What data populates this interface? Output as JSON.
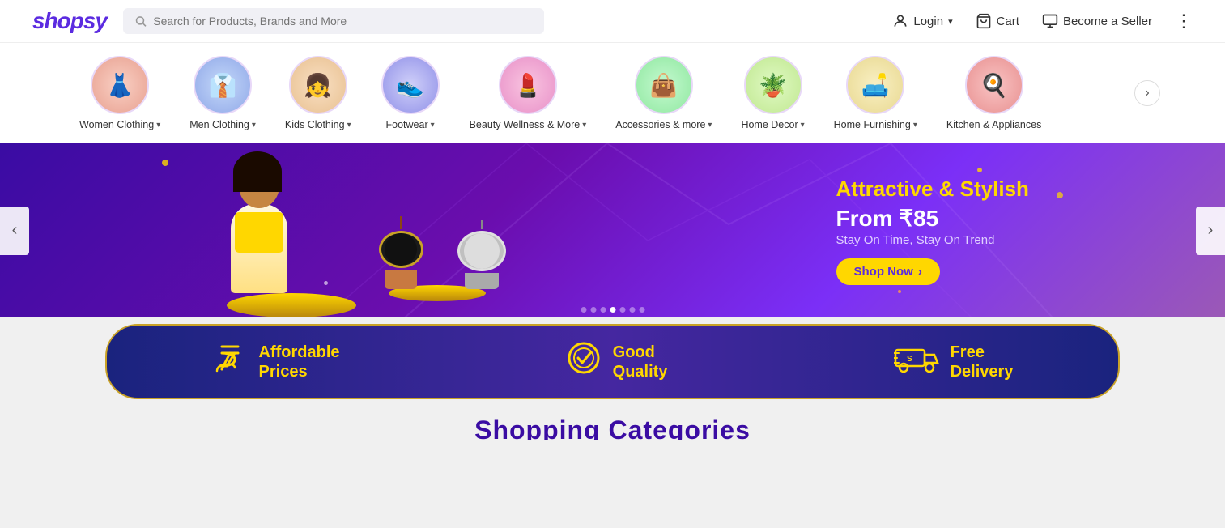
{
  "header": {
    "logo": "shopsy",
    "search": {
      "placeholder": "Search for Products, Brands and More"
    },
    "actions": {
      "login": "Login",
      "cart": "Cart",
      "become_seller": "Become a Seller"
    }
  },
  "nav": {
    "prev_arrow": "‹",
    "next_arrow": "›",
    "categories": [
      {
        "label": "Women Clothing",
        "has_dropdown": true,
        "icon": "👗",
        "circle_class": "women-circle"
      },
      {
        "label": "Men Clothing",
        "has_dropdown": true,
        "icon": "👔",
        "circle_class": "men-circle"
      },
      {
        "label": "Kids Clothing",
        "has_dropdown": true,
        "icon": "👧",
        "circle_class": "kids-circle"
      },
      {
        "label": "Footwear",
        "has_dropdown": true,
        "icon": "👟",
        "circle_class": "footwear-circle"
      },
      {
        "label": "Beauty Wellness & More",
        "has_dropdown": true,
        "icon": "💄",
        "circle_class": "beauty-circle"
      },
      {
        "label": "Accessories & more",
        "has_dropdown": true,
        "icon": "👜",
        "circle_class": "accessories-circle"
      },
      {
        "label": "Home Decor",
        "has_dropdown": true,
        "icon": "🪴",
        "circle_class": "homedecor-circle"
      },
      {
        "label": "Home Furnishing",
        "has_dropdown": true,
        "icon": "🛋️",
        "circle_class": "homefurnishing-circle"
      },
      {
        "label": "Kitchen & Appliances",
        "has_dropdown": false,
        "icon": "🍳",
        "circle_class": "kitchen-circle"
      }
    ]
  },
  "banner": {
    "title": "Attractive & Stylish",
    "price_label": "From ₹85",
    "subtitle": "Stay On Time, Stay On Trend",
    "cta": "Shop Now",
    "dots": [
      false,
      false,
      false,
      true,
      false,
      false,
      false
    ]
  },
  "features": [
    {
      "icon": "₹",
      "text": "Affordable\nPrices"
    },
    {
      "icon": "✓",
      "text": "Good\nQuality"
    },
    {
      "icon": "🚚",
      "text": "Free\nDelivery"
    }
  ],
  "shopping_categories_heading": "Shopping Categories"
}
